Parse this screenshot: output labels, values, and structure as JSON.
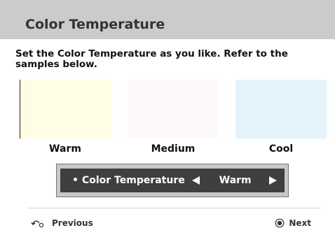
{
  "header": {
    "title": "Color Temperature"
  },
  "instruction": "Set the Color Temperature as you like. Refer to the samples below.",
  "samples": [
    {
      "label": "Warm",
      "color": "#fffde4"
    },
    {
      "label": "Medium",
      "color": "#fdf8fa"
    },
    {
      "label": "Cool",
      "color": "#e4f2fb"
    }
  ],
  "selector": {
    "bullet": "•",
    "label": "Color Temperature",
    "value": "Warm",
    "left_arrow_icon": "triangle-left-icon",
    "right_arrow_icon": "triangle-right-icon"
  },
  "footer": {
    "previous_label": "Previous",
    "previous_icon": "return-arrow-icon",
    "next_label": "Next",
    "next_icon": "radio-dot-icon"
  },
  "colors": {
    "title_bar": "#cbcbcb",
    "selector_bar": "#3f3f3f",
    "selector_frame": "#c8c8c8"
  }
}
